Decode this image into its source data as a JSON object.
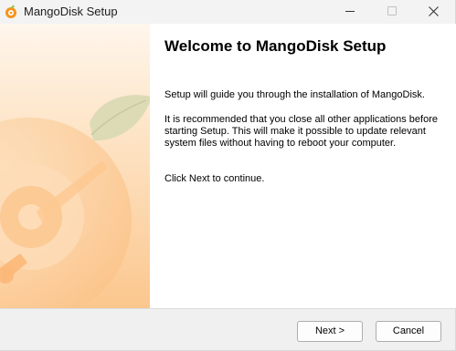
{
  "window": {
    "title": "MangoDisk Setup",
    "accent_color": "#f7931e"
  },
  "main": {
    "heading": "Welcome to MangoDisk Setup",
    "paragraphs": [
      "Setup will guide you through the installation of MangoDisk.",
      "It is recommended that you close all other applications before starting Setup. This will make it possible to update relevant system files without having to reboot your computer.",
      "Click Next to continue."
    ]
  },
  "buttons": {
    "next": "Next >",
    "cancel": "Cancel"
  }
}
